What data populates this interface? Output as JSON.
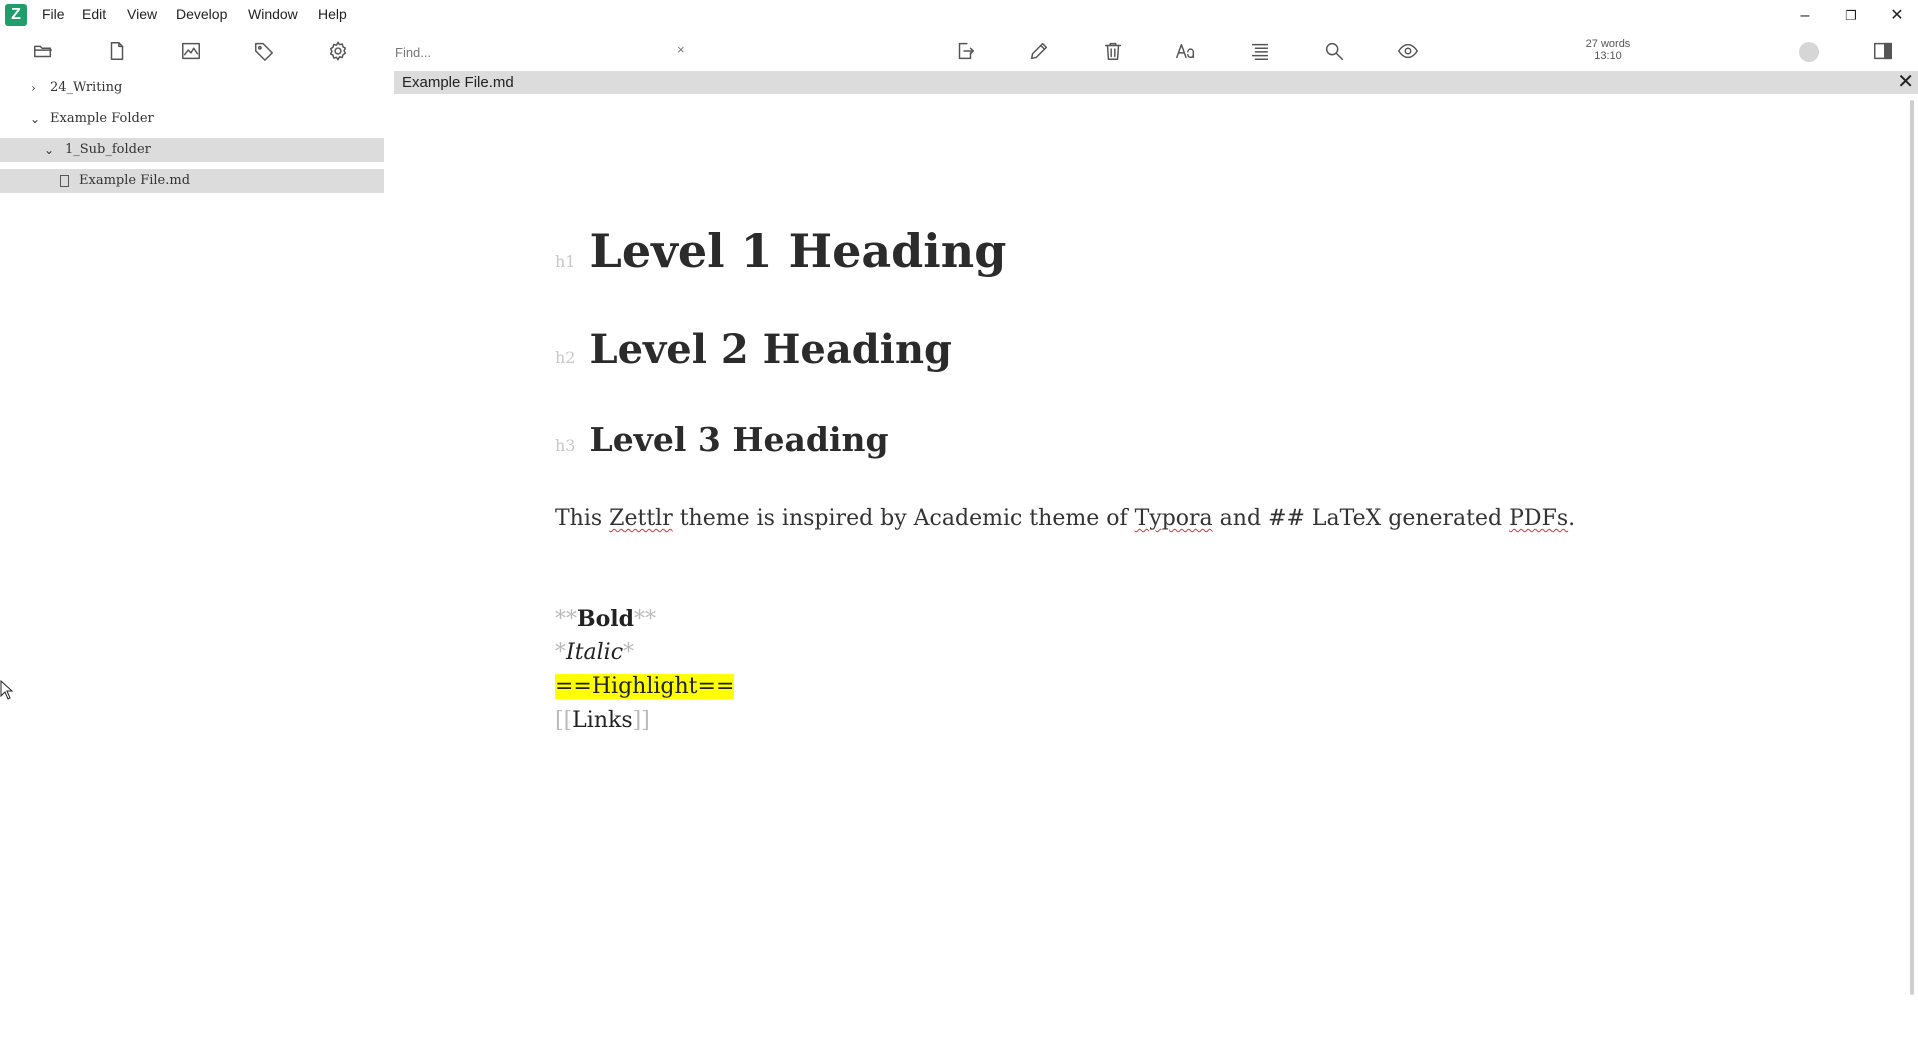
{
  "app": {
    "logo": "Z",
    "menus": [
      "File",
      "Edit",
      "View",
      "Develop",
      "Window",
      "Help"
    ]
  },
  "window_controls": {
    "minimize": "–",
    "restore": "❐",
    "close": "✕"
  },
  "toolbar": {
    "left_icons": [
      "folder-open-icon",
      "new-file-icon",
      "graph-icon",
      "tag-icon",
      "settings-icon"
    ],
    "search": {
      "placeholder": "Find...",
      "value": "",
      "clear": "×"
    },
    "center_icons": [
      "export-icon",
      "edit-icon",
      "trash-icon",
      "font-icon",
      "toc-icon",
      "search-icon",
      "preview-icon"
    ],
    "word_count": "27 words",
    "time": "13:10"
  },
  "sidebar": {
    "tree": [
      {
        "label": "24_Writing",
        "chevron": "›",
        "expanded": false
      },
      {
        "label": "Example Folder",
        "chevron": "⌄",
        "expanded": true
      },
      {
        "label": "1_Sub_folder",
        "chevron": "⌄",
        "expanded": true
      },
      {
        "label": "Example File.md"
      }
    ]
  },
  "editor": {
    "tab_title": "Example File.md",
    "tab_close": "✕",
    "headings": [
      {
        "marker": "h1",
        "text": "Level 1 Heading"
      },
      {
        "marker": "h2",
        "text": "Level 2 Heading"
      },
      {
        "marker": "h3",
        "text": "Level 3 Heading"
      }
    ],
    "paragraph": {
      "p1": "This ",
      "w1": "Zettlr",
      "p2": " theme is inspired by Academic theme of ",
      "w2": "Typora",
      "p3": " and ## LaTeX generated ",
      "w3": "PDFs",
      "p4": "."
    },
    "bold": {
      "mark": "**",
      "text": "Bold"
    },
    "italic": {
      "mark": "*",
      "text": "Italic"
    },
    "highlight": "==Highlight==",
    "link": {
      "open": "[[",
      "text": "Links",
      "close": "]]"
    }
  },
  "colors": {
    "accent": "#1f9d6a",
    "selection": "#dcdcdc",
    "highlight": "#ffff00"
  }
}
